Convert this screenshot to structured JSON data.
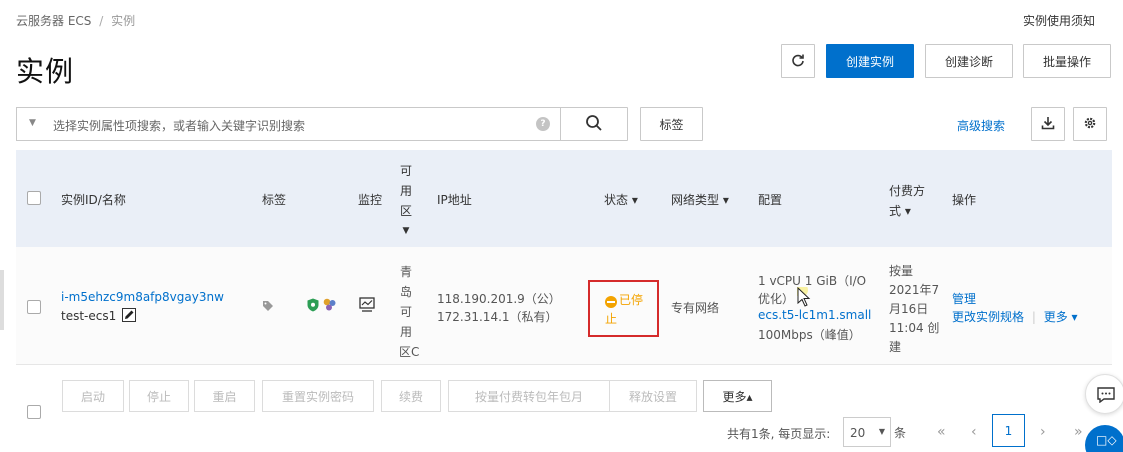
{
  "breadcrumb": {
    "root": "云服务器 ECS",
    "sep": "/",
    "current": "实例"
  },
  "notice_link": "实例使用须知",
  "page_title": "实例",
  "toolbar": {
    "refresh_icon": "C",
    "create_label": "创建实例",
    "diagnose_label": "创建诊断",
    "batch_label": "批量操作"
  },
  "search": {
    "placeholder": "选择实例属性项搜索，或者输入关键字识别搜索",
    "help_icon": "?",
    "tag_label": "标签",
    "advanced_label": "高级搜索"
  },
  "table": {
    "headers": {
      "id_name": "实例ID/名称",
      "tags": "标签",
      "monitor": "监控",
      "zone_chars": [
        "可",
        "用",
        "区"
      ],
      "ip": "IP地址",
      "status": "状态 ▾",
      "network": "网络类型 ▾",
      "config": "配置",
      "billing_1": "付费方",
      "billing_2": "式 ▾",
      "actions": "操作"
    },
    "row": {
      "instance_id": "i-m5ehzc9m8afp8vgay3nw",
      "instance_name": "test-ecs1",
      "zone_chars": [
        "青",
        "岛",
        "可",
        "用",
        "区C"
      ],
      "public_ip": "118.190.201.9（公）",
      "private_ip": "172.31.14.1（私有）",
      "status": "已停止",
      "network": "专有网络",
      "config_line1": "1 vCPU 1 GiB（I/O",
      "config_line2": "优化）",
      "config_spec": "ecs.t5-lc1m1.small",
      "config_bw": "100Mbps（峰值）",
      "billing_lines": [
        "按量",
        "2021年7",
        "月16日",
        "11:04 创",
        "建"
      ],
      "action_manage": "管理",
      "action_change": "更改实例规格",
      "action_more": "更多 ▾"
    }
  },
  "footer": {
    "buttons": [
      "启动",
      "停止",
      "重启",
      "重置实例密码",
      "续费",
      "按量付费转包年包月",
      "释放设置"
    ],
    "more_label": "更多▴",
    "total_text": "共有1条, 每页显示:",
    "page_size": "20",
    "per_unit": "条",
    "current_page": "1"
  },
  "colors": {
    "accent": "#0070cc",
    "status_stopped": "#f3a300",
    "highlight_box": "#d52b2b",
    "header_bg": "#eaeff7"
  }
}
